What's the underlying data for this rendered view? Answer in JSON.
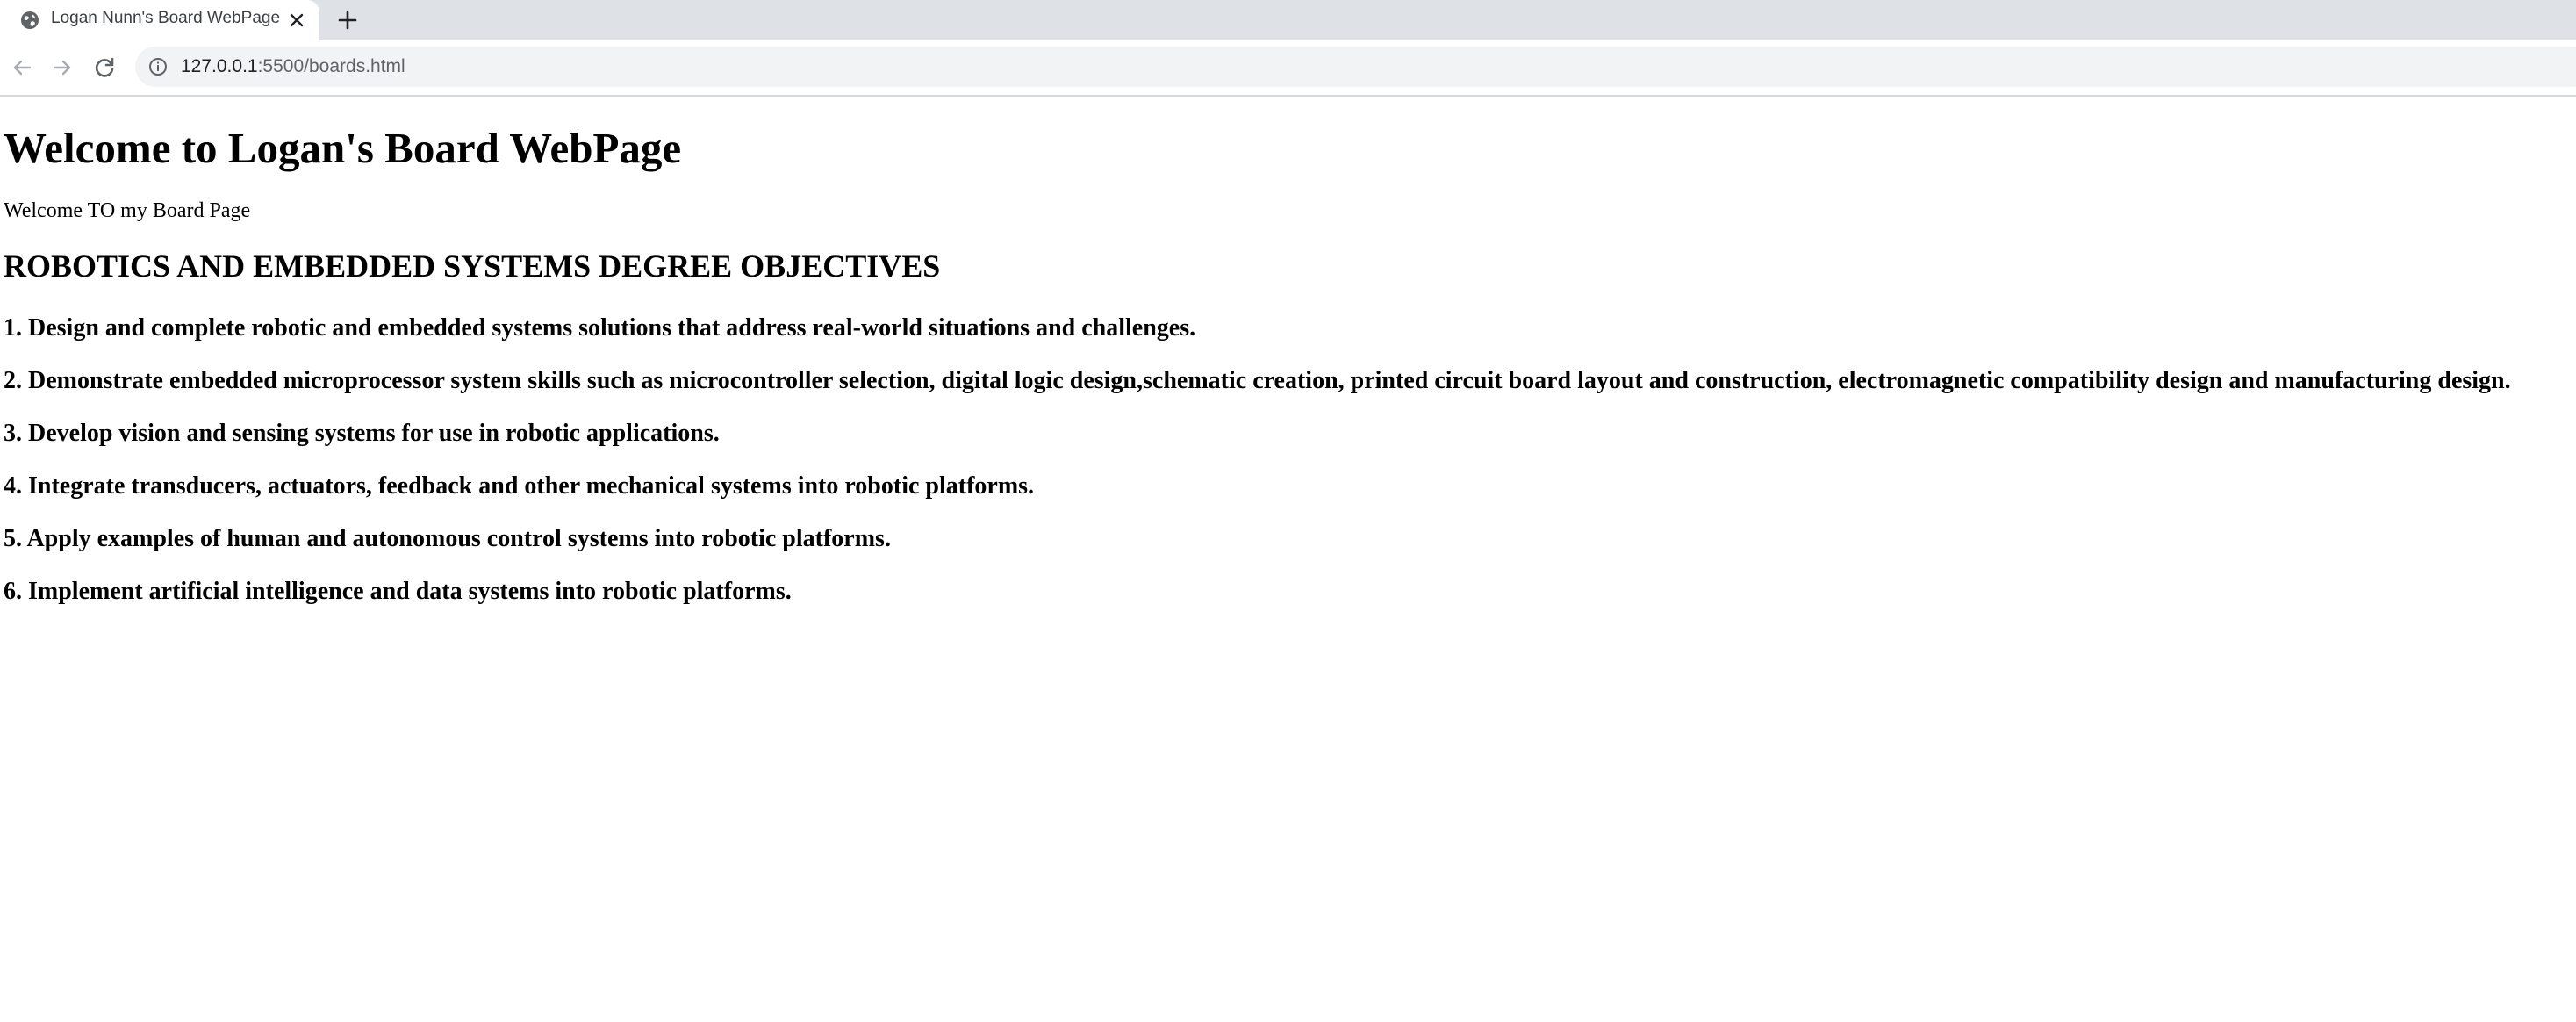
{
  "browser": {
    "tab": {
      "title": "Logan Nunn's Board WebPage"
    },
    "address_bar": {
      "host": "127.0.0.1",
      "path": ":5500/boards.html"
    }
  },
  "page": {
    "heading": "Welcome to Logan's Board WebPage",
    "intro": "Welcome TO my Board Page",
    "section_title": "ROBOTICS AND EMBEDDED SYSTEMS DEGREE OBJECTIVES",
    "objectives": [
      "1. Design and complete robotic and embedded systems solutions that address real-world situations and challenges.",
      "2. Demonstrate embedded microprocessor system skills such as microcontroller selection, digital logic design,schematic creation, printed circuit board layout and construction, electromagnetic compatibility design and manufacturing design.",
      "3. Develop vision and sensing systems for use in robotic applications.",
      "4. Integrate transducers, actuators, feedback and other mechanical systems into robotic platforms.",
      "5. Apply examples of human and autonomous control systems into robotic platforms.",
      "6. Implement artificial intelligence and data systems into robotic platforms."
    ]
  }
}
